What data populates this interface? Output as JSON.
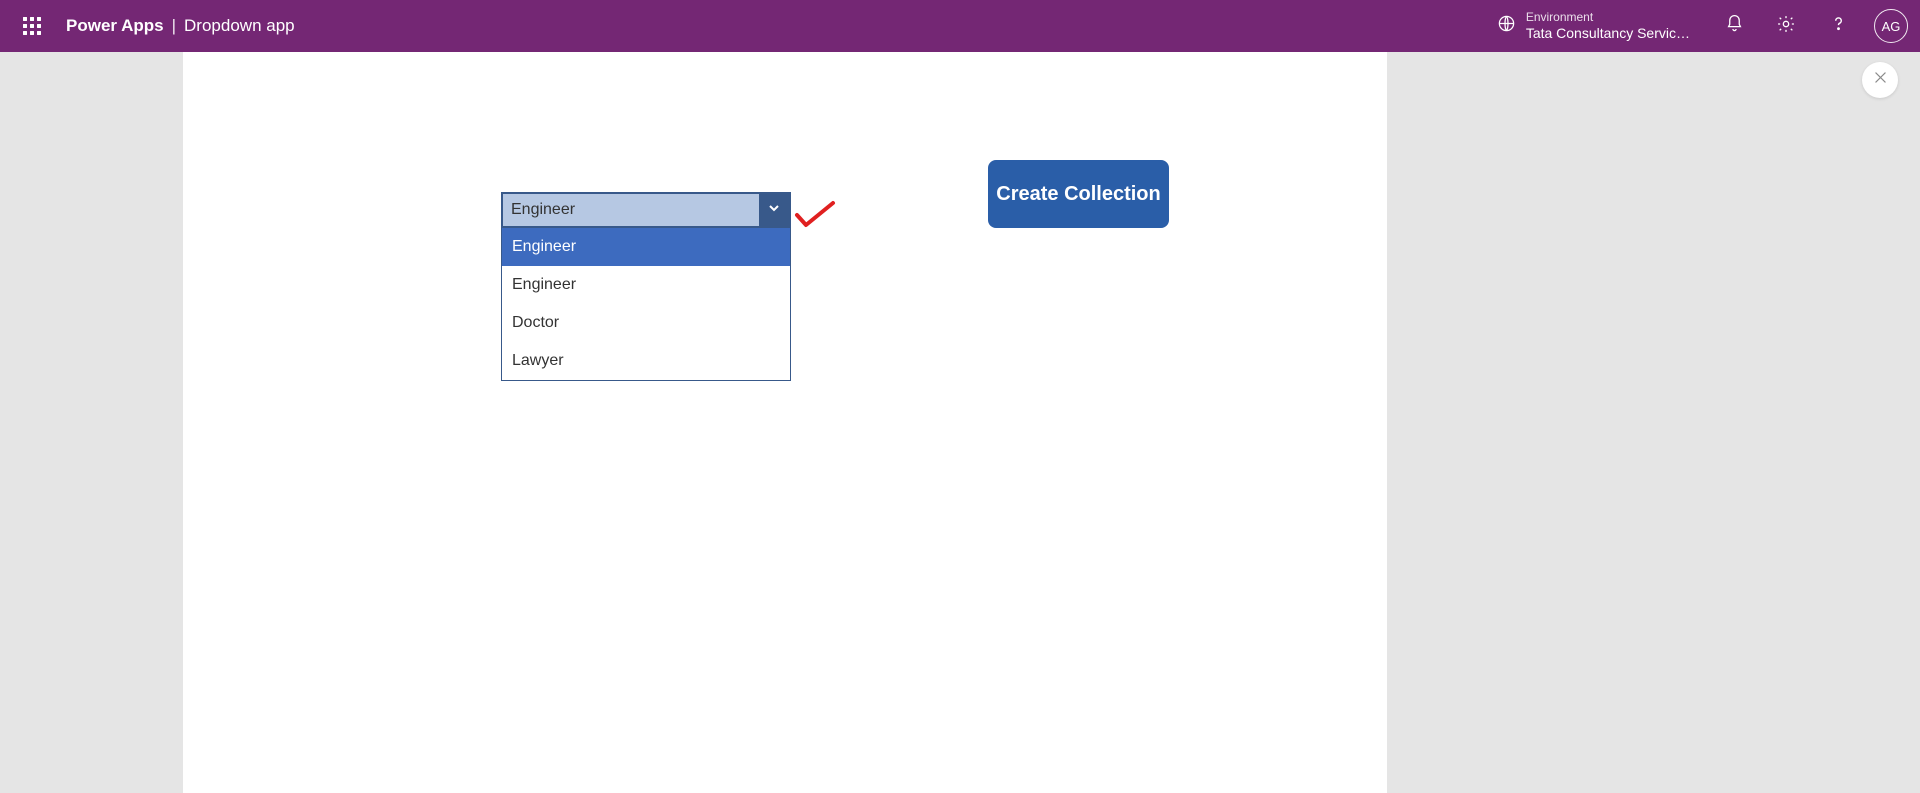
{
  "header": {
    "product": "Power Apps",
    "separator": "|",
    "appName": "Dropdown app",
    "environmentLabel": "Environment",
    "environmentName": "Tata Consultancy Servic…",
    "avatarInitials": "AG"
  },
  "canvas": {
    "dropdown": {
      "selected": "Engineer",
      "options": [
        "Engineer",
        "Engineer",
        "Doctor",
        "Lawyer"
      ],
      "highlightedIndex": 0
    },
    "button": {
      "label": "Create Collection"
    }
  }
}
